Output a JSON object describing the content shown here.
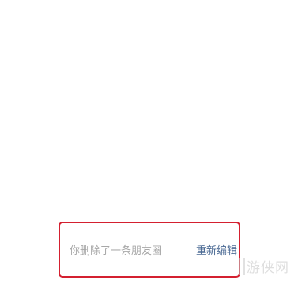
{
  "notice": {
    "text": "你删除了一条朋友圈",
    "reedit_label": "重新编辑"
  },
  "highlight": {
    "color": "#d42030"
  },
  "watermark": {
    "text": "游侠网"
  },
  "colors": {
    "notice_text": "#a8a8a8",
    "link": "#4b6a94",
    "background": "#ffffff"
  }
}
